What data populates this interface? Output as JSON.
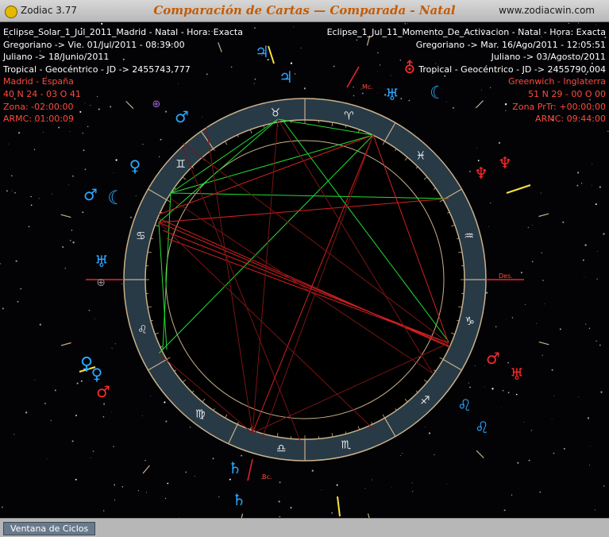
{
  "app": {
    "name": "Zodiac 3.77",
    "title": "Comparación de Cartas — Comparada - Natal",
    "website": "www.zodiacwin.com"
  },
  "left_chart": [
    "Eclipse_Solar_1_Jul_2011_Madrid - Natal - Hora: Exacta",
    "Gregoriano -> Vie. 01/Jul/2011 - 08:39:00",
    "Juliano -> 18/Junio/2011",
    "Tropical - Geocéntrico - JD -> 2455743,777",
    "Madrid - España",
    "40 N 24 - 03 O 41",
    "Zona: -02:00:00",
    "ARMC: 01:00:09"
  ],
  "right_chart": [
    "Eclipse_1_Jul_11_Momento_De_Activacion - Natal - Hora: Exacta",
    "Gregoriano -> Mar. 16/Ago/2011 - 12:05:51",
    "Juliano -> 03/Agosto/2011",
    "Tropical - Geocéntrico - JD -> 2455790,004",
    "Greenwich - Inglaterra",
    "51 N 29 - 00 O 00",
    "Zona PrTr: +00:00:00",
    "ARMC: 09:44:00"
  ],
  "axis_labels": {
    "mc": "Mc.",
    "ds": "Des.",
    "bc": "Bc."
  },
  "signs": [
    "♈",
    "♉",
    "♊",
    "♋",
    "♌",
    "♍",
    "♎",
    "♏",
    "♐",
    "♑",
    "♒",
    "♓"
  ],
  "planet_glyphs": [
    "♃",
    "♃",
    "⊕",
    "♂",
    "♀",
    "♂",
    "☾",
    "♅",
    "⊕",
    "♀",
    "♀",
    "♂",
    "⛢",
    "♆",
    "♆",
    "☾",
    "♅",
    "♂",
    "♅",
    "♅",
    "♌",
    "♌",
    "♄",
    "♄"
  ],
  "colors": {
    "wheel_band": "#283a46",
    "ring": "#c8b08a",
    "aspect_green": "#22dd33",
    "aspect_red": "#d42020",
    "aspect_dark": "#7a1414",
    "glyph_blue": "#2aa8ff",
    "glyph_red": "#ff2a2a",
    "label_red": "#ff4a3a"
  },
  "footer": {
    "button": "Ventana de Ciclos"
  }
}
